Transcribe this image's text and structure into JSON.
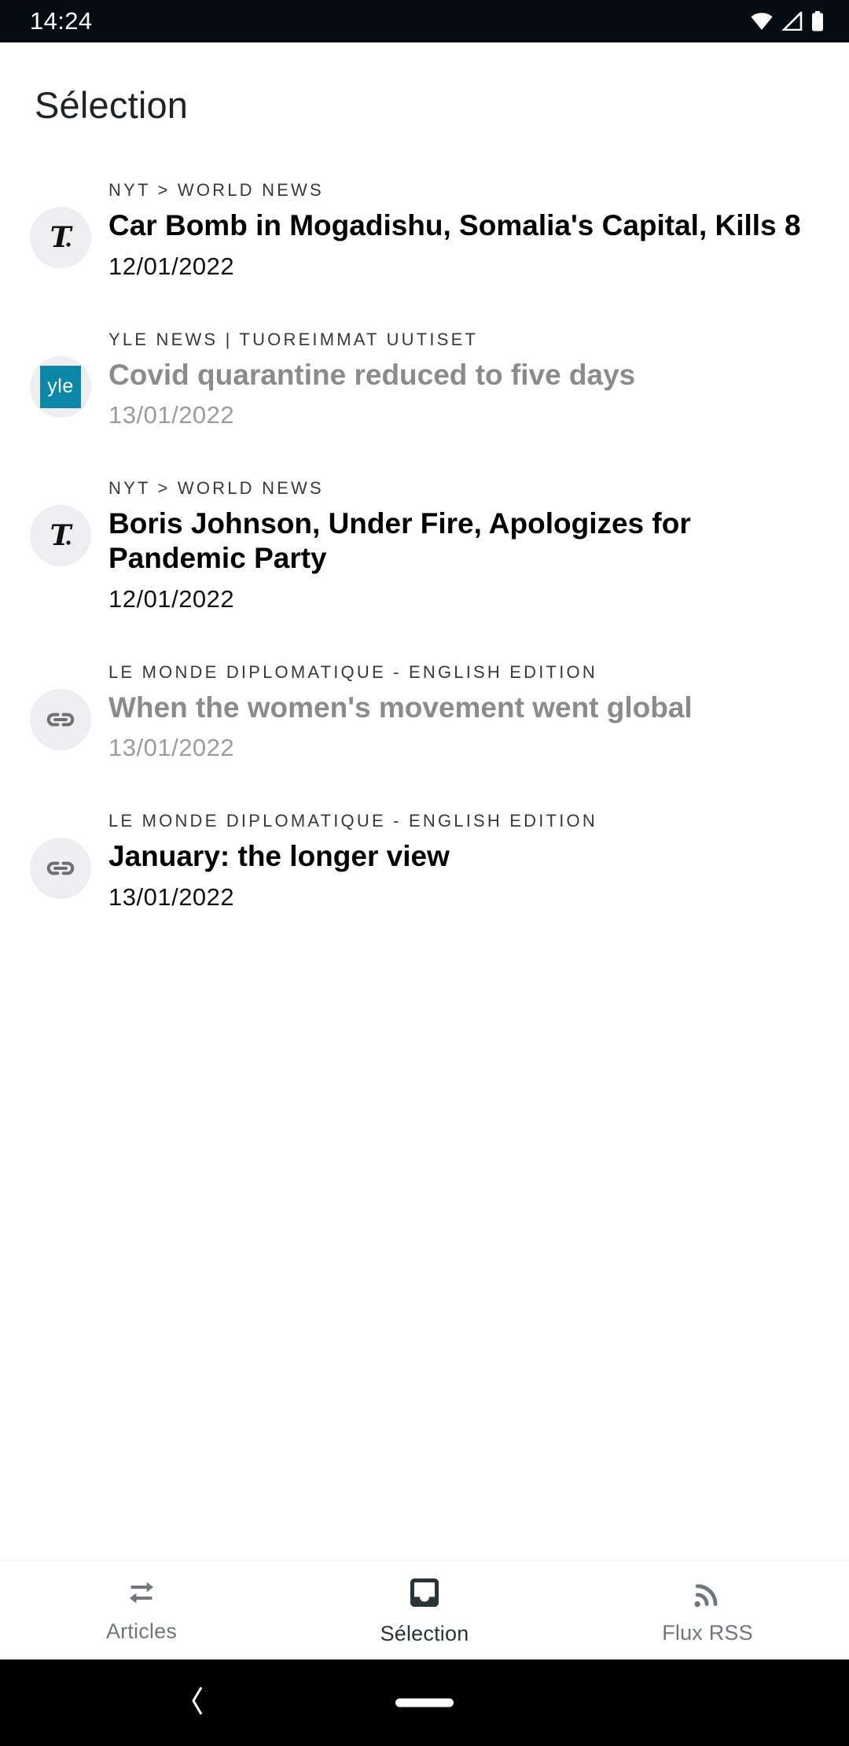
{
  "status_bar": {
    "time": "14:24",
    "icons": [
      "wifi-icon",
      "cellular-signal-icon",
      "battery-icon"
    ]
  },
  "app_bar": {
    "title": "Sélection"
  },
  "colors": {
    "accent_yle": "#0c87a8",
    "text_primary": "#000000",
    "text_read": "#8b8b8b",
    "avatar_bg": "#eeeef0",
    "nav_active": "#2b3238",
    "nav_inactive": "#6f757a"
  },
  "list": {
    "items": [
      {
        "source": "NYT > WORLD NEWS",
        "title": "Car Bomb in Mogadishu, Somalia's Capital, Kills 8",
        "date": "12/01/2022",
        "icon": "nyt-logo-icon",
        "read": false
      },
      {
        "source": "YLE NEWS | TUOREIMMAT UUTISET",
        "title": "Covid quarantine reduced to five days",
        "date": "13/01/2022",
        "icon": "yle-logo-icon",
        "logo_text": "yle",
        "read": true
      },
      {
        "source": "NYT > WORLD NEWS",
        "title": "Boris Johnson, Under Fire, Apologizes for Pandemic Party",
        "date": "12/01/2022",
        "icon": "nyt-logo-icon",
        "read": false
      },
      {
        "source": "LE MONDE DIPLOMATIQUE - ENGLISH EDITION",
        "title": "When the women's movement went global",
        "date": "13/01/2022",
        "icon": "link-icon",
        "read": true
      },
      {
        "source": "LE MONDE DIPLOMATIQUE - ENGLISH EDITION",
        "title": "January: the longer view",
        "date": "13/01/2022",
        "icon": "link-icon",
        "read": false
      }
    ]
  },
  "bottom_nav": {
    "items": [
      {
        "label": "Articles",
        "icon": "swap-arrows-icon",
        "active": false
      },
      {
        "label": "Sélection",
        "icon": "bookmark-inbox-icon",
        "active": true
      },
      {
        "label": "Flux RSS",
        "icon": "rss-icon",
        "active": false
      }
    ]
  },
  "system_nav": {
    "back": "back-chevron-icon",
    "home": "home-pill-icon"
  }
}
